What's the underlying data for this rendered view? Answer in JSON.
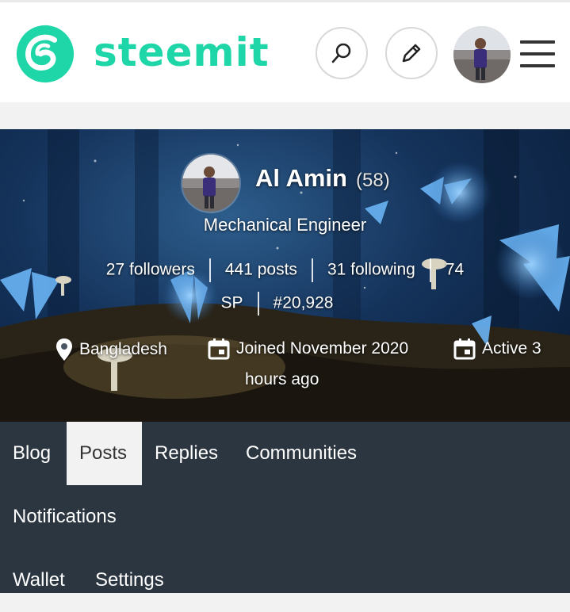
{
  "header": {
    "brand": "steemit",
    "brand_color": "#1ed6a7",
    "icons": [
      "search-icon",
      "pencil-icon",
      "menu-icon"
    ]
  },
  "profile": {
    "name": "Al Amin",
    "reputation": "(58)",
    "about": "Mechanical Engineer",
    "followers": "27 followers",
    "posts": "441 posts",
    "following": "31 following",
    "sp_value": "74",
    "sp_unit": "SP",
    "rank": "#20,928",
    "location": "Bangladesh",
    "joined": "Joined November 2020",
    "active_line1": "Active 3",
    "active_line2": "hours ago"
  },
  "tabs": {
    "blog": "Blog",
    "posts": "Posts",
    "replies": "Replies",
    "communities": "Communities",
    "notifications": "Notifications",
    "wallet": "Wallet",
    "settings": "Settings",
    "active": "Posts"
  }
}
